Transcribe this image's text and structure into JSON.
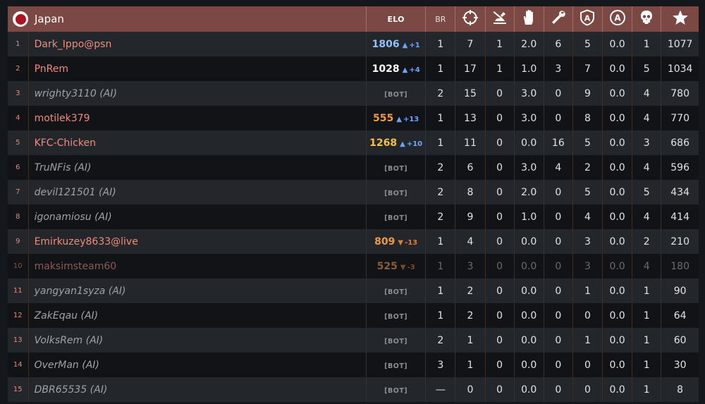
{
  "team": {
    "name": "Japan",
    "flag": "japan-flag"
  },
  "headers": {
    "elo": "ELO",
    "br": "BR",
    "icons": [
      "crosshair-icon",
      "ground-kill-icon",
      "assist-icon",
      "repair-icon",
      "base-capture-icon",
      "air-capture-icon",
      "deaths-skull-icon",
      "score-star-icon"
    ]
  },
  "colors": {
    "header_bg": "#7c4843",
    "player_name": "#ef8b7c",
    "ai_name": "#9ea3a8",
    "elo_blue": "#8ec2ff",
    "elo_white": "#ffffff",
    "elo_orange": "#f09a42",
    "elo_yellow": "#f5c242",
    "up_arrow": "#6aa6ff",
    "down_arrow": "#e07a3a"
  },
  "rows": [
    {
      "rank": "1",
      "name": "Dark_Ippo@psn",
      "ai": false,
      "elo": "1806",
      "trend": "up",
      "delta": "+1",
      "elo_color": "#8ec2ff",
      "br": "1",
      "kills": "7",
      "ground": "1",
      "assists": "2.0",
      "repair": "6",
      "captures": "5",
      "air": "0.0",
      "deaths": "1",
      "score": "1077",
      "dim": false
    },
    {
      "rank": "2",
      "name": "PnRem",
      "ai": false,
      "elo": "1028",
      "trend": "up",
      "delta": "+4",
      "elo_color": "#ffffff",
      "br": "1",
      "kills": "17",
      "ground": "1",
      "assists": "1.0",
      "repair": "3",
      "captures": "7",
      "air": "0.0",
      "deaths": "5",
      "score": "1034",
      "dim": false
    },
    {
      "rank": "3",
      "name": "wrighty3110 (AI)",
      "ai": true,
      "elo": "[BOT]",
      "trend": "",
      "delta": "",
      "elo_color": "",
      "br": "2",
      "kills": "15",
      "ground": "0",
      "assists": "3.0",
      "repair": "0",
      "captures": "9",
      "air": "0.0",
      "deaths": "4",
      "score": "780",
      "dim": false
    },
    {
      "rank": "4",
      "name": "motilek379",
      "ai": false,
      "elo": "555",
      "trend": "up",
      "delta": "+13",
      "elo_color": "#f09a42",
      "br": "1",
      "kills": "13",
      "ground": "0",
      "assists": "3.0",
      "repair": "0",
      "captures": "8",
      "air": "0.0",
      "deaths": "4",
      "score": "770",
      "dim": false
    },
    {
      "rank": "5",
      "name": "KFC-Chicken",
      "ai": false,
      "elo": "1268",
      "trend": "up",
      "delta": "+10",
      "elo_color": "#f5c242",
      "br": "1",
      "kills": "11",
      "ground": "0",
      "assists": "0.0",
      "repair": "16",
      "captures": "5",
      "air": "0.0",
      "deaths": "3",
      "score": "686",
      "dim": false
    },
    {
      "rank": "6",
      "name": "TruNFis (AI)",
      "ai": true,
      "elo": "[BOT]",
      "trend": "",
      "delta": "",
      "elo_color": "",
      "br": "2",
      "kills": "6",
      "ground": "0",
      "assists": "3.0",
      "repair": "4",
      "captures": "2",
      "air": "0.0",
      "deaths": "4",
      "score": "596",
      "dim": false
    },
    {
      "rank": "7",
      "name": "devil121501 (AI)",
      "ai": true,
      "elo": "[BOT]",
      "trend": "",
      "delta": "",
      "elo_color": "",
      "br": "2",
      "kills": "8",
      "ground": "0",
      "assists": "2.0",
      "repair": "0",
      "captures": "5",
      "air": "0.0",
      "deaths": "5",
      "score": "434",
      "dim": false
    },
    {
      "rank": "8",
      "name": "igonamiosu (AI)",
      "ai": true,
      "elo": "[BOT]",
      "trend": "",
      "delta": "",
      "elo_color": "",
      "br": "2",
      "kills": "9",
      "ground": "0",
      "assists": "1.0",
      "repair": "0",
      "captures": "4",
      "air": "0.0",
      "deaths": "4",
      "score": "414",
      "dim": false
    },
    {
      "rank": "9",
      "name": "Emirkuzey8633@live",
      "ai": false,
      "elo": "809",
      "trend": "down",
      "delta": "-13",
      "elo_color": "#f09a42",
      "br": "1",
      "kills": "4",
      "ground": "0",
      "assists": "0.0",
      "repair": "0",
      "captures": "3",
      "air": "0.0",
      "deaths": "2",
      "score": "210",
      "dim": false
    },
    {
      "rank": "10",
      "name": "maksimsteam60",
      "ai": false,
      "elo": "525",
      "trend": "down",
      "delta": "-3",
      "elo_color": "#8a5c3a",
      "br": "1",
      "kills": "3",
      "ground": "0",
      "assists": "0.0",
      "repair": "0",
      "captures": "3",
      "air": "0.0",
      "deaths": "4",
      "score": "180",
      "dim": true
    },
    {
      "rank": "11",
      "name": "yangyan1syza (AI)",
      "ai": true,
      "elo": "[BOT]",
      "trend": "",
      "delta": "",
      "elo_color": "",
      "br": "1",
      "kills": "2",
      "ground": "0",
      "assists": "0.0",
      "repair": "0",
      "captures": "1",
      "air": "0.0",
      "deaths": "1",
      "score": "90",
      "dim": false
    },
    {
      "rank": "12",
      "name": "ZakEqau (AI)",
      "ai": true,
      "elo": "[BOT]",
      "trend": "",
      "delta": "",
      "elo_color": "",
      "br": "1",
      "kills": "2",
      "ground": "0",
      "assists": "0.0",
      "repair": "0",
      "captures": "0",
      "air": "0.0",
      "deaths": "1",
      "score": "64",
      "dim": false
    },
    {
      "rank": "13",
      "name": "VolksRem (AI)",
      "ai": true,
      "elo": "[BOT]",
      "trend": "",
      "delta": "",
      "elo_color": "",
      "br": "2",
      "kills": "1",
      "ground": "0",
      "assists": "0.0",
      "repair": "0",
      "captures": "1",
      "air": "0.0",
      "deaths": "1",
      "score": "60",
      "dim": false
    },
    {
      "rank": "14",
      "name": "OverMan (AI)",
      "ai": true,
      "elo": "[BOT]",
      "trend": "",
      "delta": "",
      "elo_color": "",
      "br": "3",
      "kills": "1",
      "ground": "0",
      "assists": "0.0",
      "repair": "0",
      "captures": "0",
      "air": "0.0",
      "deaths": "1",
      "score": "30",
      "dim": false
    },
    {
      "rank": "15",
      "name": "DBR65535 (AI)",
      "ai": true,
      "elo": "[BOT]",
      "trend": "",
      "delta": "",
      "elo_color": "",
      "br": "—",
      "kills": "0",
      "ground": "0",
      "assists": "0.0",
      "repair": "0",
      "captures": "0",
      "air": "0.0",
      "deaths": "1",
      "score": "8",
      "dim": false
    }
  ]
}
